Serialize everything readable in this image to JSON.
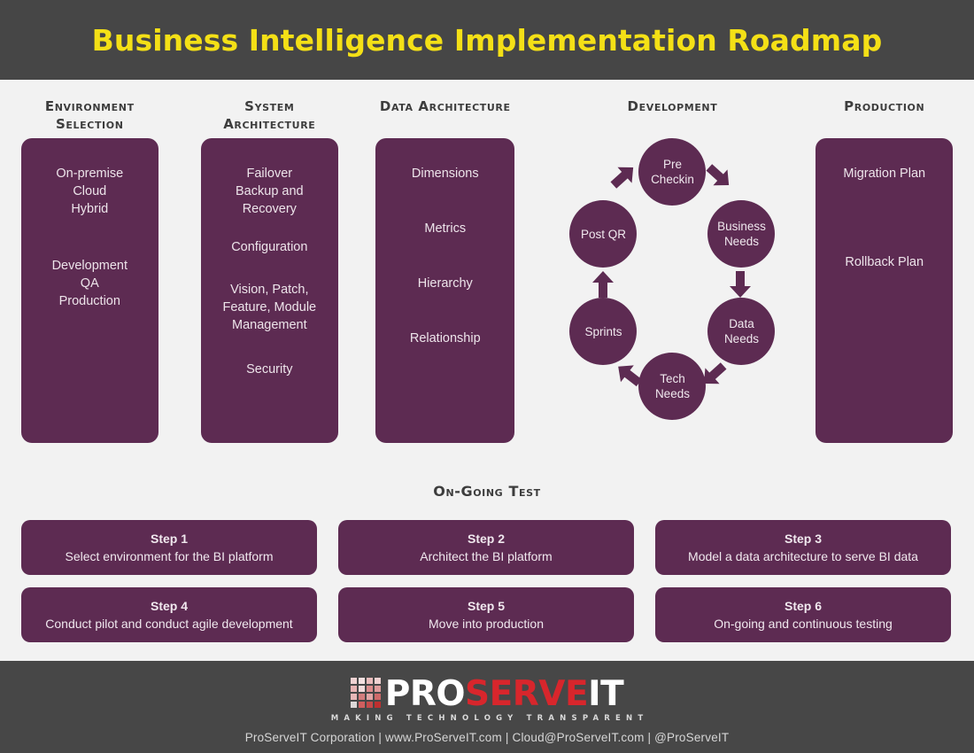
{
  "header": {
    "title": "Business Intelligence Implementation Roadmap",
    "title_color": "#f4e016",
    "bg_color": "#464646"
  },
  "theme": {
    "card_purple": "#5d2b52",
    "page_bg": "#f2f2f2",
    "heading_gray": "#3d3d3d"
  },
  "columns": [
    {
      "heading": "Environment Selection",
      "heading_line1": "Environment",
      "heading_line2": "Selection",
      "groups": [
        [
          "On-premise",
          "Cloud",
          "Hybrid"
        ],
        [
          "Development",
          "QA",
          "Production"
        ]
      ]
    },
    {
      "heading": "System Architecture",
      "heading_line1": "System",
      "heading_line2": "Architecture",
      "groups": [
        [
          "Failover",
          "Backup and",
          "Recovery"
        ],
        [
          "Configuration"
        ],
        [
          "Vision, Patch,",
          "Feature, Module",
          "Management"
        ],
        [
          "Security"
        ]
      ]
    },
    {
      "heading": "Data Architecture",
      "heading_line1": "Data Architecture",
      "heading_line2": "",
      "groups": [
        [
          "Dimensions"
        ],
        [
          "Metrics"
        ],
        [
          "Hierarchy"
        ],
        [
          "Relationship"
        ]
      ]
    },
    {
      "heading": "Development",
      "heading_line1": "Development",
      "heading_line2": ""
    },
    {
      "heading": "Production",
      "heading_line1": "Production",
      "heading_line2": "",
      "groups": [
        [
          "Migration Plan"
        ],
        [
          "Rollback Plan"
        ]
      ]
    }
  ],
  "cycle": {
    "nodes": [
      {
        "id": "pre-checkin",
        "line1": "Pre",
        "line2": "Checkin"
      },
      {
        "id": "business-needs",
        "line1": "Business",
        "line2": "Needs"
      },
      {
        "id": "data-needs",
        "line1": "Data",
        "line2": "Needs"
      },
      {
        "id": "tech-needs",
        "line1": "Tech",
        "line2": "Needs"
      },
      {
        "id": "sprints",
        "line1": "Sprints",
        "line2": ""
      },
      {
        "id": "post-qr",
        "line1": "Post QR",
        "line2": ""
      }
    ],
    "flow": "Pre Checkin → Business Needs → Data Needs → Tech Needs → Sprints → Post QR → Pre Checkin"
  },
  "ongoing": {
    "title": "On-Going Test"
  },
  "steps": [
    {
      "label": "Step 1",
      "desc": "Select environment for the BI platform"
    },
    {
      "label": "Step 2",
      "desc": "Architect the BI platform"
    },
    {
      "label": "Step 3",
      "desc": "Model a data architecture to serve BI data"
    },
    {
      "label": "Step 4",
      "desc": "Conduct pilot and conduct agile development"
    },
    {
      "label": "Step 5",
      "desc": "Move into production"
    },
    {
      "label": "Step 6",
      "desc": "On-going and continuous testing"
    }
  ],
  "footer": {
    "logo_pro": "PRO",
    "logo_serve": "SERVE",
    "logo_it": "IT",
    "tagline": "MAKING TECHNOLOGY TRANSPARENT",
    "contact": "ProServeIT Corporation  |  www.ProServeIT.com  |  Cloud@ProServeIT.com  |  @ProServeIT",
    "bg_color": "#474747",
    "accent_red": "#d8262c"
  }
}
